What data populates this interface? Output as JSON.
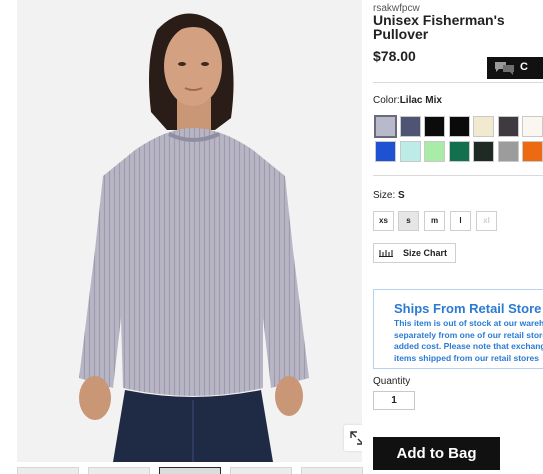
{
  "product": {
    "sku": "rsakwfpcw",
    "title_line1": "Unisex Fisherman's",
    "title_line2": "Pullover",
    "price": "$78.00"
  },
  "chat": {
    "label": "C",
    "icon": "chat-bubbles-icon"
  },
  "color": {
    "label": "Color:",
    "selected": "Lilac Mix",
    "swatches": [
      [
        "#b9b9cc",
        "#4f5474",
        "#0b0b0b",
        "#0a0a0a",
        "#f1ead0",
        "#3f3a3f",
        "#fbf7f0"
      ],
      [
        "#1e52d2",
        "#bdece8",
        "#a9eca7",
        "#13704f",
        "#202a25",
        "#9c9c9c",
        "#ee6a12"
      ]
    ]
  },
  "size": {
    "label": "Size:",
    "selected": "S",
    "options": [
      "xs",
      "s",
      "m",
      "l",
      "xl"
    ],
    "chart_label": "Size Chart"
  },
  "shipping": {
    "title": "Ships From Retail Store",
    "lines": [
      "This item is out of stock at our warehouse",
      "separately from one of our retail stores at no",
      "added cost. Please note that exchanges for",
      "items shipped from our retail stores"
    ]
  },
  "quantity": {
    "label": "Quantity",
    "value": "1"
  },
  "cart": {
    "add_label": "Add to Bag"
  },
  "image": {
    "zoom_icon": "expand-icon"
  }
}
